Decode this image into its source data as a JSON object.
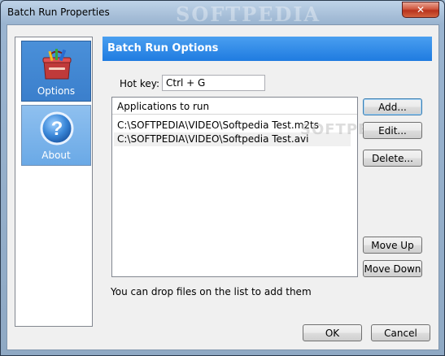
{
  "window": {
    "title": "Batch Run Properties",
    "close_label": "✕"
  },
  "watermark": "SOFTPEDIA",
  "sidebar": {
    "items": [
      {
        "label": "Options",
        "icon": "toolbox-icon",
        "selected": true
      },
      {
        "label": "About",
        "icon": "help-icon",
        "selected": false
      }
    ]
  },
  "main": {
    "header": "Batch Run Options",
    "hotkey_label": "Hot key:",
    "hotkey_value": "Ctrl + G",
    "apps_header": "Applications to run",
    "apps": [
      "C:\\SOFTPEDIA\\VIDEO\\Softpedia Test.m2ts",
      "C:\\SOFTPEDIA\\VIDEO\\Softpedia Test.avi"
    ],
    "drop_hint": "You can drop files on the list to add them"
  },
  "buttons": {
    "add": "Add...",
    "edit": "Edit...",
    "delete": "Delete...",
    "move_up": "Move Up",
    "move_down": "Move Down",
    "ok": "OK",
    "cancel": "Cancel"
  }
}
